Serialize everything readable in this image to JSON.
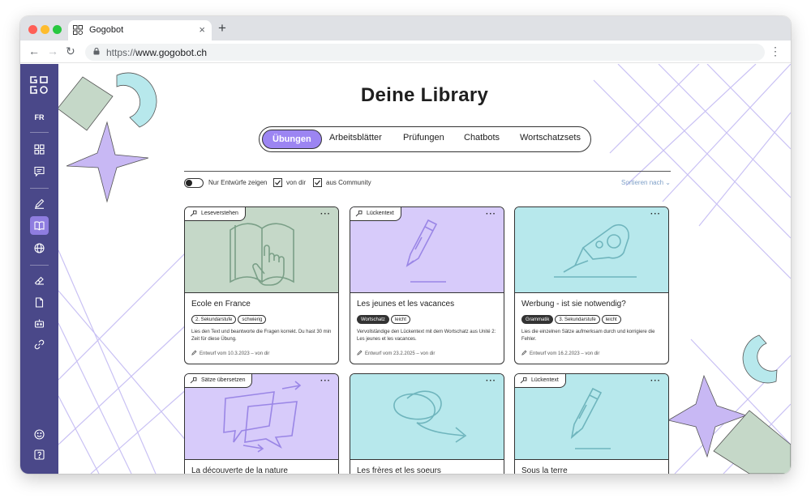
{
  "browser": {
    "tab_title": "Gogobot",
    "url_scheme": "https://",
    "url_host": "www.gogobot.ch"
  },
  "sidebar": {
    "language": "FR",
    "items": [
      {
        "icon": "dashboard-grid-icon"
      },
      {
        "icon": "chat-icon"
      },
      {
        "icon": "pencil-icon"
      },
      {
        "icon": "library-book-icon",
        "active": true
      },
      {
        "icon": "globe-icon"
      },
      {
        "icon": "eraser-icon"
      },
      {
        "icon": "document-icon"
      },
      {
        "icon": "robot-icon"
      },
      {
        "icon": "link-icon"
      },
      {
        "icon": "smiley-icon"
      },
      {
        "icon": "help-icon"
      }
    ]
  },
  "page": {
    "title": "Deine Library"
  },
  "tabs": [
    {
      "label": "Übungen",
      "active": true
    },
    {
      "label": "Arbeitsblätter"
    },
    {
      "label": "Prüfungen"
    },
    {
      "label": "Chatbots"
    },
    {
      "label": "Wortschatzsets"
    }
  ],
  "filters": {
    "drafts_label": "Nur Entwürfe zeigen",
    "drafts_on": false,
    "from_you_label": "von dir",
    "from_you_checked": true,
    "community_label": "aus Community",
    "community_checked": true,
    "sort_label": "Sortieren nach"
  },
  "colors": {
    "sidebar": "#4a4889",
    "accent_purple": "#9c85f2",
    "card_green": "#c5d8c8",
    "card_purple": "#d7cbfa",
    "card_cyan": "#b7e8ec"
  },
  "cards": [
    {
      "type": "Leseverstehen",
      "title": "Ecole en France",
      "tags": [
        {
          "label": "2. Sekundarstufe"
        },
        {
          "label": "schwierig"
        }
      ],
      "description": "Lies den Text und beantworte die Fragen korrekt. Du hast 30 min Zeit für diese Übung.",
      "meta": "Entwurf vom 10.3.2023 – von dir",
      "color": "#c5d8c8",
      "illustration": "book-icon"
    },
    {
      "type": "Lückentext",
      "title": "Les jeunes et les vacances",
      "tags": [
        {
          "label": "Wortschatz",
          "dark": true
        },
        {
          "label": "leicht"
        }
      ],
      "description": "Vervollständige den Lückentext mit dem Wortschatz aus Unité 2: Les jeunes et les vacances.",
      "meta": "Entwurf vom 23.2.2025 – von dir",
      "color": "#d7cbfa",
      "illustration": "pencil-icon"
    },
    {
      "type": "",
      "title": "Werbung - ist sie notwendig?",
      "tags": [
        {
          "label": "Grammatik",
          "dark": true
        },
        {
          "label": "3. Sekundarstufe"
        },
        {
          "label": "leicht"
        }
      ],
      "description": "Lies die einzelnen Sätze aufmerksam durch und korrigiere die Fehler.",
      "meta": "Entwurf vom 16.2.2023 – von dir",
      "color": "#b7e8ec",
      "illustration": "correction-tape-icon"
    },
    {
      "type": "Sätze übersetzen",
      "title": "La découverte de la nature",
      "tags": [],
      "description": "",
      "meta": "",
      "color": "#d7cbfa",
      "illustration": "speech-bubbles-icon"
    },
    {
      "type": "",
      "title": "Les frères et les soeurs",
      "tags": [],
      "description": "",
      "meta": "",
      "color": "#b7e8ec",
      "illustration": "scribble-arrow-icon"
    },
    {
      "type": "Lückentext",
      "title": "Sous la terre",
      "tags": [],
      "description": "",
      "meta": "",
      "color": "#b7e8ec",
      "illustration": "pencil-icon"
    }
  ]
}
